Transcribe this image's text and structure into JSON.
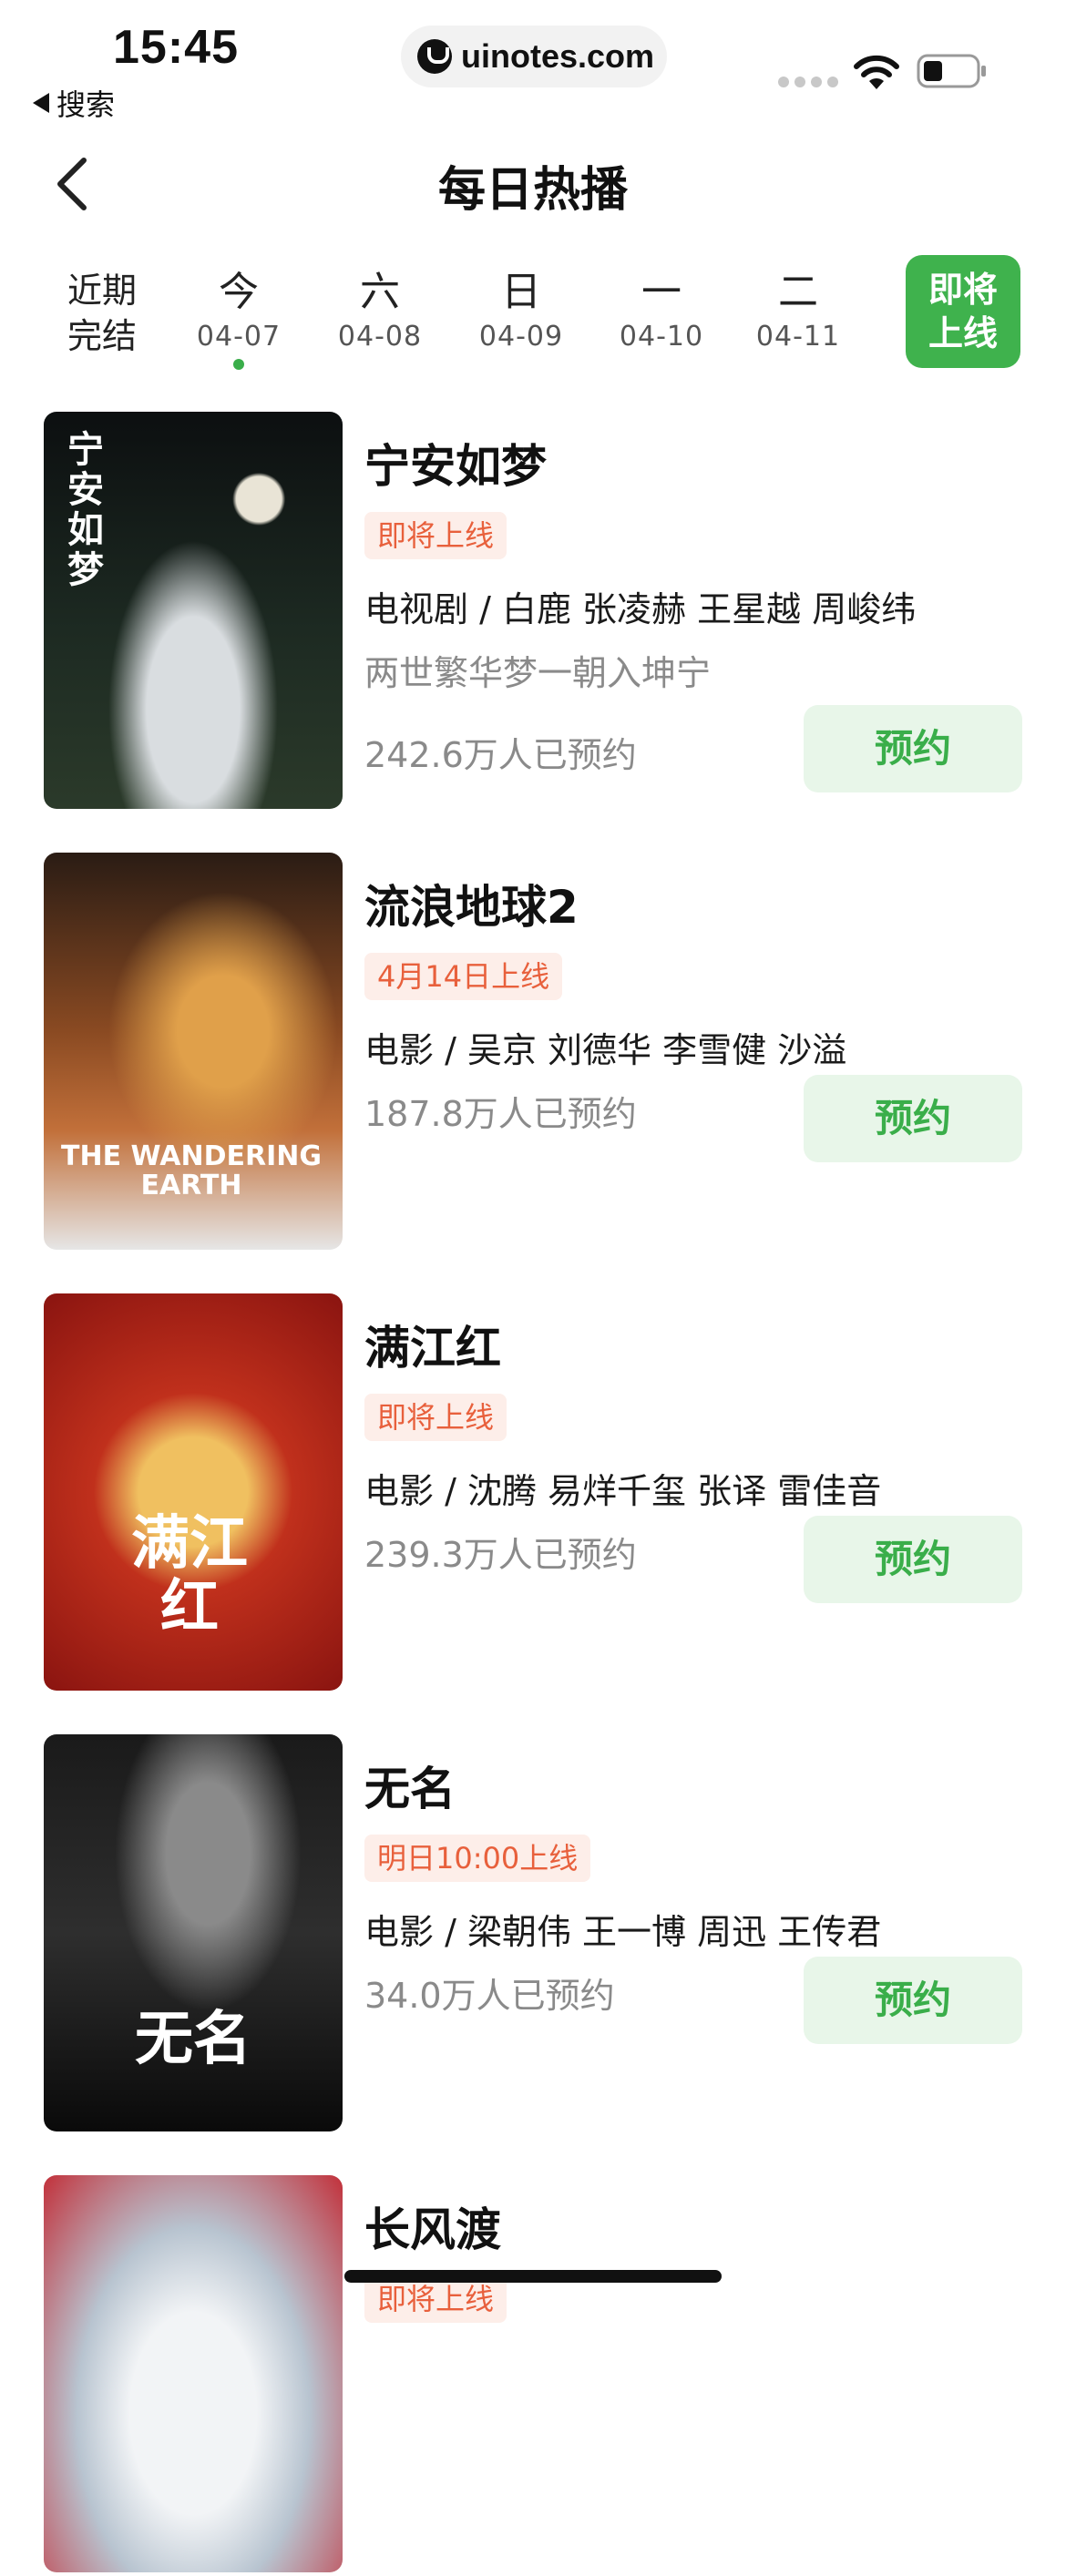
{
  "status_bar": {
    "time": "15:45",
    "back_app_label": "搜索",
    "url": "uinotes.com"
  },
  "nav": {
    "title": "每日热播"
  },
  "date_tabs": {
    "recent": {
      "line1": "近期",
      "line2": "完结"
    },
    "days": [
      {
        "weekday": "今",
        "date": "04-07",
        "selected": true
      },
      {
        "weekday": "六",
        "date": "04-08",
        "selected": false
      },
      {
        "weekday": "日",
        "date": "04-09",
        "selected": false
      },
      {
        "weekday": "一",
        "date": "04-10",
        "selected": false
      },
      {
        "weekday": "二",
        "date": "04-11",
        "selected": false
      }
    ],
    "upcoming": {
      "line1": "即将",
      "line2": "上线"
    }
  },
  "shows": [
    {
      "title": "宁安如梦",
      "badge": "即将上线",
      "meta": "电视剧 / 白鹿 张凌赫 王星越 周峻纬",
      "subtitle": "两世繁华梦一朝入坤宁",
      "count": "242.6万人已预约",
      "button": "预约",
      "poster_text": "宁安如梦"
    },
    {
      "title": "流浪地球2",
      "badge": "4月14日上线",
      "meta": "电影 / 吴京 刘德华 李雪健 沙溢",
      "subtitle": "",
      "count": "187.8万人已预约",
      "button": "预约",
      "poster_text": "THE WANDERING EARTH"
    },
    {
      "title": "满江红",
      "badge": "即将上线",
      "meta": "电影 / 沈腾 易烊千玺 张译 雷佳音",
      "subtitle": "",
      "count": "239.3万人已预约",
      "button": "预约",
      "poster_text": "满江红"
    },
    {
      "title": "无名",
      "badge": "明日10:00上线",
      "meta": "电影 / 梁朝伟 王一博 周迅 王传君",
      "subtitle": "",
      "count": "34.0万人已预约",
      "button": "预约",
      "poster_text": "无名"
    },
    {
      "title": "长风渡",
      "badge": "即将上线",
      "meta": "",
      "subtitle": "",
      "count": "",
      "button": "",
      "poster_text": ""
    }
  ],
  "colors": {
    "accent_green": "#3fb24d",
    "badge_text": "#e8603c",
    "badge_bg": "#fdeee9",
    "button_bg": "#e8f6e9"
  }
}
